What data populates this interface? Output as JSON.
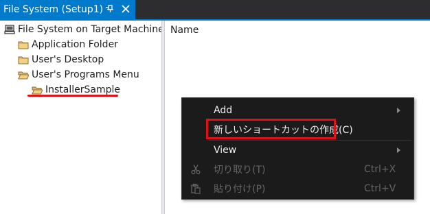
{
  "tab": {
    "title": "File System (Setup1)",
    "pin_icon": "pin-icon",
    "close_icon": "close-icon",
    "accent": "#007acc"
  },
  "tree": {
    "root": {
      "label": "File System on Target Machine",
      "icon": "computer-icon"
    },
    "items": [
      {
        "label": "Application Folder",
        "icon": "folder-icon"
      },
      {
        "label": "User's Desktop",
        "icon": "folder-icon"
      },
      {
        "label": "User's Programs Menu",
        "icon": "folder-open-icon"
      },
      {
        "label": "InstallerSample",
        "icon": "folder-open-icon"
      }
    ]
  },
  "list": {
    "column_header": "Name"
  },
  "context_menu": {
    "items": [
      {
        "label": "Add",
        "submenu": true,
        "enabled": true
      },
      {
        "label": "新しいショートカットの作成(C)",
        "submenu": false,
        "enabled": true
      },
      {
        "label": "View",
        "submenu": true,
        "enabled": true
      },
      {
        "label": "切り取り(T)",
        "shortcut": "Ctrl+X",
        "icon": "scissors-icon",
        "enabled": false
      },
      {
        "label": "貼り付け(P)",
        "shortcut": "Ctrl+V",
        "icon": "paste-icon",
        "enabled": false
      }
    ]
  },
  "annotation_color": "#e0101a"
}
